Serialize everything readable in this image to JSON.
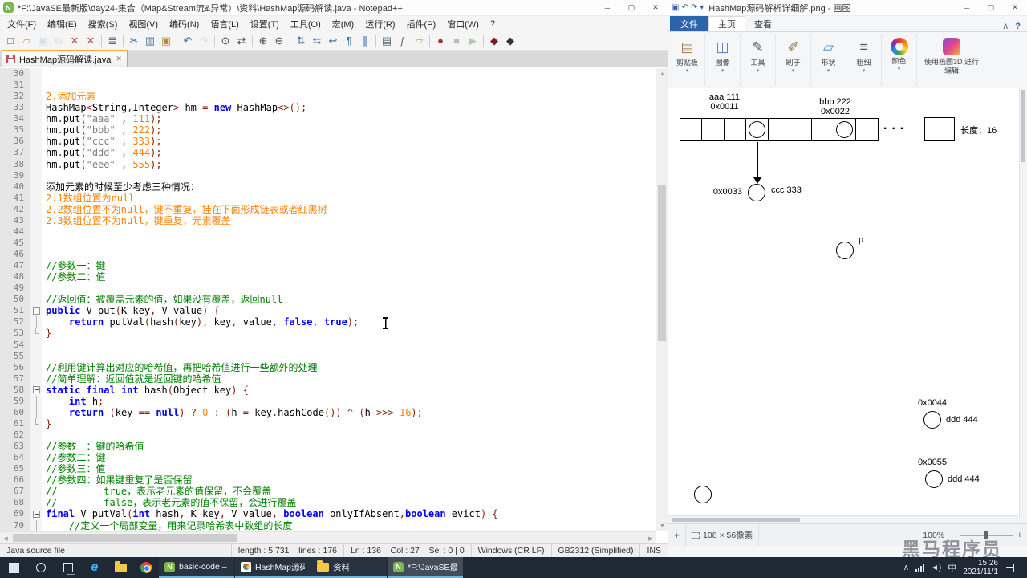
{
  "notepad": {
    "title": "*F:\\JavaSE最新版\\day24-集合（Map&Stream流&异常）\\资料\\HashMap源码解读.java - Notepad++",
    "logo_letter": "N",
    "menus": [
      "文件(F)",
      "编辑(E)",
      "搜索(S)",
      "视图(V)",
      "编码(N)",
      "语言(L)",
      "设置(T)",
      "工具(O)",
      "宏(M)",
      "运行(R)",
      "插件(P)",
      "窗口(W)",
      "?"
    ],
    "toolbar": [
      {
        "name": "new-file-icon",
        "g": "□",
        "c": "#5a5a5a"
      },
      {
        "name": "open-file-icon",
        "g": "▱",
        "c": "#d79b3a"
      },
      {
        "name": "save-icon",
        "g": "▣",
        "c": "#9fb6cd",
        "d": 1
      },
      {
        "name": "save-all-icon",
        "g": "⧉",
        "c": "#9fb6cd",
        "d": 1
      },
      {
        "name": "close-file-icon",
        "g": "✕",
        "c": "#b05050"
      },
      {
        "name": "close-all-icon",
        "g": "✕",
        "c": "#b05050"
      },
      {
        "name": "print-icon",
        "g": "≣",
        "c": "#5a6a7a",
        "sep": 1
      },
      {
        "name": "cut-icon",
        "g": "✂",
        "c": "#3a6ea5",
        "sep": 1
      },
      {
        "name": "copy-icon",
        "g": "▥",
        "c": "#3a6ea5"
      },
      {
        "name": "paste-icon",
        "g": "▣",
        "c": "#b08840"
      },
      {
        "name": "undo-icon",
        "g": "↶",
        "c": "#2e75b6",
        "sep": 1
      },
      {
        "name": "redo-icon",
        "g": "↷",
        "c": "#9fb6cd",
        "d": 1
      },
      {
        "name": "find-icon",
        "g": "⊙",
        "c": "#444444",
        "sep": 1
      },
      {
        "name": "replace-icon",
        "g": "⇄",
        "c": "#444444"
      },
      {
        "name": "zoom-in-icon",
        "g": "⊕",
        "c": "#444444",
        "sep": 1
      },
      {
        "name": "zoom-out-icon",
        "g": "⊖",
        "c": "#444444"
      },
      {
        "name": "sync-scroll-v-icon",
        "g": "⇅",
        "c": "#3a6ea5",
        "sep": 1
      },
      {
        "name": "sync-scroll-h-icon",
        "g": "⇆",
        "c": "#3a6ea5"
      },
      {
        "name": "word-wrap-icon",
        "g": "↩",
        "c": "#3a6ea5"
      },
      {
        "name": "show-all-chars-icon",
        "g": "¶",
        "c": "#3a6ea5"
      },
      {
        "name": "indent-guide-icon",
        "g": "∥",
        "c": "#3a6ea5"
      },
      {
        "name": "doc-map-icon",
        "g": "▤",
        "c": "#5a6a7a",
        "sep": 1
      },
      {
        "name": "function-list-icon",
        "g": "ƒ",
        "c": "#5a6a7a"
      },
      {
        "name": "folder-workspace-icon",
        "g": "▱",
        "c": "#d79b3a"
      },
      {
        "name": "record-macro-icon",
        "g": "●",
        "c": "#a33333",
        "sep": 1
      },
      {
        "name": "stop-macro-icon",
        "g": "■",
        "c": "#555555",
        "d": 1
      },
      {
        "name": "play-macro-icon",
        "g": "▶",
        "c": "#2e7d32",
        "d": 1
      },
      {
        "name": "plugin-icon-1",
        "g": "◆",
        "c": "#7b1b1b",
        "sep": 1
      },
      {
        "name": "plugin-icon-2",
        "g": "◆",
        "c": "#333333"
      }
    ],
    "tab_label": "HashMap源码解读.java",
    "tab_close": "✕",
    "lines": [
      {
        "n": 30,
        "f": "",
        "s": []
      },
      {
        "n": 31,
        "f": "",
        "s": []
      },
      {
        "n": 32,
        "f": "",
        "s": [
          [
            "2.添加元素",
            "n"
          ]
        ]
      },
      {
        "n": 33,
        "f": "",
        "s": [
          [
            "HashMap",
            "p"
          ],
          [
            "<",
            "o"
          ],
          [
            "String",
            "p"
          ],
          [
            ",",
            "o"
          ],
          [
            "Integer",
            "p"
          ],
          [
            ">",
            "o"
          ],
          [
            " hm ",
            "p"
          ],
          [
            "=",
            "o"
          ],
          [
            " ",
            "p"
          ],
          [
            "new",
            "k"
          ],
          [
            " HashMap",
            "p"
          ],
          [
            "<>();",
            "o"
          ]
        ]
      },
      {
        "n": 34,
        "f": "",
        "s": [
          [
            "hm",
            "p"
          ],
          [
            ".",
            "o"
          ],
          [
            "put",
            "p"
          ],
          [
            "(",
            "o"
          ],
          [
            "\"aaa\"",
            "s"
          ],
          [
            " , ",
            "o"
          ],
          [
            "111",
            "n"
          ],
          [
            ");",
            "o"
          ]
        ]
      },
      {
        "n": 35,
        "f": "",
        "s": [
          [
            "hm",
            "p"
          ],
          [
            ".",
            "o"
          ],
          [
            "put",
            "p"
          ],
          [
            "(",
            "o"
          ],
          [
            "\"bbb\"",
            "s"
          ],
          [
            " , ",
            "o"
          ],
          [
            "222",
            "n"
          ],
          [
            ");",
            "o"
          ]
        ]
      },
      {
        "n": 36,
        "f": "",
        "s": [
          [
            "hm",
            "p"
          ],
          [
            ".",
            "o"
          ],
          [
            "put",
            "p"
          ],
          [
            "(",
            "o"
          ],
          [
            "\"ccc\"",
            "s"
          ],
          [
            " , ",
            "o"
          ],
          [
            "333",
            "n"
          ],
          [
            ");",
            "o"
          ]
        ]
      },
      {
        "n": 37,
        "f": "",
        "s": [
          [
            "hm",
            "p"
          ],
          [
            ".",
            "o"
          ],
          [
            "put",
            "p"
          ],
          [
            "(",
            "o"
          ],
          [
            "\"ddd\"",
            "s"
          ],
          [
            " , ",
            "o"
          ],
          [
            "444",
            "n"
          ],
          [
            ");",
            "o"
          ]
        ]
      },
      {
        "n": 38,
        "f": "",
        "s": [
          [
            "hm",
            "p"
          ],
          [
            ".",
            "o"
          ],
          [
            "put",
            "p"
          ],
          [
            "(",
            "o"
          ],
          [
            "\"eee\"",
            "s"
          ],
          [
            " , ",
            "o"
          ],
          [
            "555",
            "n"
          ],
          [
            ");",
            "o"
          ]
        ]
      },
      {
        "n": 39,
        "f": "",
        "s": []
      },
      {
        "n": 40,
        "f": "",
        "s": [
          [
            "添加元素的时候至少考虑三种情况：",
            "p"
          ]
        ]
      },
      {
        "n": 41,
        "f": "",
        "s": [
          [
            "2.1数组位置为null",
            "n"
          ]
        ]
      },
      {
        "n": 42,
        "f": "",
        "s": [
          [
            "2.2数组位置不为null，键不重复，挂在下面形成链表或者红黑树",
            "n"
          ]
        ]
      },
      {
        "n": 43,
        "f": "",
        "s": [
          [
            "2.3数组位置不为null，键重复，元素覆盖",
            "n"
          ]
        ]
      },
      {
        "n": 44,
        "f": "",
        "s": []
      },
      {
        "n": 45,
        "f": "",
        "s": []
      },
      {
        "n": 46,
        "f": "",
        "s": []
      },
      {
        "n": 47,
        "f": "",
        "s": [
          [
            "//参数一：键",
            "c"
          ]
        ]
      },
      {
        "n": 48,
        "f": "",
        "s": [
          [
            "//参数二：值",
            "c"
          ]
        ]
      },
      {
        "n": 49,
        "f": "",
        "s": []
      },
      {
        "n": 50,
        "f": "",
        "s": [
          [
            "//返回值：被覆盖元素的值，如果没有覆盖，返回null",
            "c"
          ]
        ]
      },
      {
        "n": 51,
        "f": "open",
        "s": [
          [
            "public",
            "k"
          ],
          [
            " V put",
            "p"
          ],
          [
            "(",
            "o"
          ],
          [
            "K key",
            "p"
          ],
          [
            ", ",
            "o"
          ],
          [
            "V value",
            "p"
          ],
          [
            ") {",
            "o"
          ]
        ]
      },
      {
        "n": 52,
        "f": "mid",
        "s": [
          [
            "    ",
            "p"
          ],
          [
            "return",
            "k"
          ],
          [
            " putVal",
            "p"
          ],
          [
            "(",
            "o"
          ],
          [
            "hash",
            "p"
          ],
          [
            "(",
            "o"
          ],
          [
            "key",
            "p"
          ],
          [
            "),",
            "o"
          ],
          [
            " key",
            "p"
          ],
          [
            ",",
            "o"
          ],
          [
            " value",
            "p"
          ],
          [
            ", ",
            "o"
          ],
          [
            "false",
            "k"
          ],
          [
            ", ",
            "o"
          ],
          [
            "true",
            "k"
          ],
          [
            ");",
            "o"
          ]
        ]
      },
      {
        "n": 53,
        "f": "end",
        "s": [
          [
            "}",
            "o"
          ]
        ]
      },
      {
        "n": 54,
        "f": "",
        "s": []
      },
      {
        "n": 55,
        "f": "",
        "s": []
      },
      {
        "n": 56,
        "f": "",
        "s": [
          [
            "//利用键计算出对应的哈希值，再把哈希值进行一些额外的处理",
            "c"
          ]
        ]
      },
      {
        "n": 57,
        "f": "",
        "s": [
          [
            "//简单理解：返回值就是返回键的哈希值",
            "c"
          ]
        ]
      },
      {
        "n": 58,
        "f": "open",
        "s": [
          [
            "static",
            "k"
          ],
          [
            " ",
            "p"
          ],
          [
            "final",
            "k"
          ],
          [
            " ",
            "p"
          ],
          [
            "int",
            "k"
          ],
          [
            " hash",
            "p"
          ],
          [
            "(",
            "o"
          ],
          [
            "Object key",
            "p"
          ],
          [
            ") {",
            "o"
          ]
        ]
      },
      {
        "n": 59,
        "f": "mid",
        "s": [
          [
            "    ",
            "p"
          ],
          [
            "int",
            "k"
          ],
          [
            " h",
            "p"
          ],
          [
            ";",
            "o"
          ]
        ]
      },
      {
        "n": 60,
        "f": "mid",
        "s": [
          [
            "    ",
            "p"
          ],
          [
            "return",
            "k"
          ],
          [
            " ",
            "p"
          ],
          [
            "(",
            "o"
          ],
          [
            "key ",
            "p"
          ],
          [
            "==",
            "o"
          ],
          [
            " ",
            "p"
          ],
          [
            "null",
            "k"
          ],
          [
            ")",
            "o"
          ],
          [
            " ",
            "p"
          ],
          [
            "?",
            "o"
          ],
          [
            " ",
            "p"
          ],
          [
            "0",
            "n"
          ],
          [
            " ",
            "p"
          ],
          [
            ":",
            "o"
          ],
          [
            " ",
            "p"
          ],
          [
            "(",
            "o"
          ],
          [
            "h ",
            "p"
          ],
          [
            "=",
            "o"
          ],
          [
            " key",
            "p"
          ],
          [
            ".",
            "o"
          ],
          [
            "hashCode",
            "p"
          ],
          [
            "())",
            "o"
          ],
          [
            " ",
            "p"
          ],
          [
            "^",
            "o"
          ],
          [
            " ",
            "p"
          ],
          [
            "(",
            "o"
          ],
          [
            "h ",
            "p"
          ],
          [
            ">>>",
            "o"
          ],
          [
            " ",
            "p"
          ],
          [
            "16",
            "n"
          ],
          [
            ");",
            "o"
          ]
        ]
      },
      {
        "n": 61,
        "f": "end",
        "s": [
          [
            "}",
            "o"
          ]
        ]
      },
      {
        "n": 62,
        "f": "",
        "s": []
      },
      {
        "n": 63,
        "f": "",
        "s": [
          [
            "//参数一：键的哈希值",
            "c"
          ]
        ]
      },
      {
        "n": 64,
        "f": "",
        "s": [
          [
            "//参数二：键",
            "c"
          ]
        ]
      },
      {
        "n": 65,
        "f": "",
        "s": [
          [
            "//参数三：值",
            "c"
          ]
        ]
      },
      {
        "n": 66,
        "f": "",
        "s": [
          [
            "//参数四：如果键重复了是否保留",
            "c"
          ]
        ]
      },
      {
        "n": 67,
        "f": "",
        "s": [
          [
            "//        true，表示老元素的值保留，不会覆盖",
            "c"
          ]
        ]
      },
      {
        "n": 68,
        "f": "",
        "s": [
          [
            "//        false，表示老元素的值不保留，会进行覆盖",
            "c"
          ]
        ]
      },
      {
        "n": 69,
        "f": "open",
        "s": [
          [
            "final",
            "k"
          ],
          [
            " V putVal",
            "p"
          ],
          [
            "(",
            "o"
          ],
          [
            "int",
            "k"
          ],
          [
            " hash",
            "p"
          ],
          [
            ", ",
            "o"
          ],
          [
            "K key",
            "p"
          ],
          [
            ", ",
            "o"
          ],
          [
            "V value",
            "p"
          ],
          [
            ", ",
            "o"
          ],
          [
            "boolean",
            "k"
          ],
          [
            " onlyIfAbsent",
            "p"
          ],
          [
            ",",
            "o"
          ],
          [
            "boolean",
            "k"
          ],
          [
            " evict",
            "p"
          ],
          [
            ") {",
            "o"
          ]
        ]
      },
      {
        "n": 70,
        "f": "mid",
        "s": [
          [
            "    ",
            "p"
          ],
          [
            "//定义一个局部变量，用来记录哈希表中数组的长度",
            "c"
          ]
        ]
      }
    ],
    "status": {
      "doc_type": "Java source file",
      "length_info": "length : 5,731    lines : 176",
      "caret_info": "Ln : 136    Col : 27    Sel : 0 | 0",
      "eol": "Windows (CR LF)",
      "encoding": "GB2312 (Simplified)",
      "typing_mode": "INS"
    }
  },
  "win_controls": {
    "min": "─",
    "max": "▢",
    "close": "✕"
  },
  "paint": {
    "title": "HashMap源码解析详细解.png - 画图",
    "qat": [
      {
        "name": "save-icon",
        "g": "▣"
      },
      {
        "name": "undo-icon",
        "g": "↶"
      },
      {
        "name": "redo-icon",
        "g": "↷"
      },
      {
        "name": "qat-dropdown-icon",
        "g": "▾"
      }
    ],
    "tabs": [
      {
        "label": "文件",
        "type": "file"
      },
      {
        "label": "主页",
        "active": true
      },
      {
        "label": "查看"
      }
    ],
    "ribbon_extras": {
      "collapse": "∧",
      "help": "?"
    },
    "groups": [
      {
        "label": "剪贴板",
        "icon": "clipboard-icon",
        "g": "▤",
        "c": "#a6784e"
      },
      {
        "label": "图像",
        "icon": "image-select-icon",
        "g": "◫",
        "c": "#5b7fb9"
      },
      {
        "label": "工具",
        "icon": "pencil-icon",
        "g": "✎",
        "c": "#555555"
      },
      {
        "label": "刷子",
        "icon": "brush-icon",
        "g": "✐",
        "c": "#8a6d3b"
      },
      {
        "label": "形状",
        "icon": "shapes-icon",
        "g": "▱",
        "c": "#4a90d9"
      },
      {
        "label": "粗细",
        "icon": "line-width-icon",
        "g": "≡",
        "c": "#555555"
      },
      {
        "label": "颜色",
        "icon": "palette-icon",
        "g": "",
        "c": ""
      }
    ],
    "group_arrow": "▾",
    "paint3d_label": "使用画图3D 进行编辑",
    "diagram": {
      "aaa_line1": "aaa 111",
      "aaa_line2": "0x0011",
      "bbb_line1": "bbb 222",
      "bbb_line2": "0x0022",
      "cells": [
        0,
        0,
        0,
        1,
        0,
        0,
        0,
        1,
        0
      ],
      "dots": "···",
      "length_label": "长度：16",
      "ccc_addr": "0x0033",
      "ccc_val": "ccc 333",
      "p_label": "p",
      "d1_addr": "0x0044",
      "d1_val": "ddd 444",
      "d2_addr": "0x0055",
      "d2_val": "ddd 444"
    },
    "status": {
      "selection_size": "108 × 56像素",
      "zoom": "100%",
      "zoom_out": "−",
      "zoom_in": "+"
    }
  },
  "taskbar": {
    "buttons": [
      {
        "app": "notepadpp",
        "label": "basic-code – Has..."
      },
      {
        "app": "paint",
        "label": "HashMap源码解..."
      },
      {
        "app": "folder",
        "label": "资料"
      },
      {
        "app": "notepadpp",
        "label": "*F:\\JavaSE最新版\\...",
        "active": true
      }
    ],
    "tray": {
      "hidden_icons": "∧",
      "ime": "中",
      "time": "15:26",
      "date": "2021/11/1"
    }
  },
  "watermark": "黑马程序员"
}
